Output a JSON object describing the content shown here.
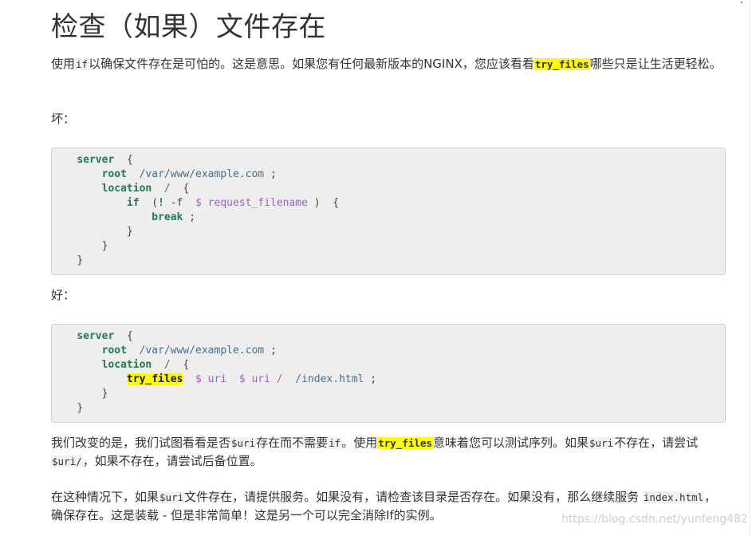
{
  "title": "检查（如果）文件存在",
  "intro": {
    "t1": "使用",
    "c1": "if",
    "t2": "以确保文件存在是可怕的。这是意思。如果您有任何最新版本的NGINX，您应该看看",
    "c2": "try_files",
    "t3": "哪些只是让生活更轻松。"
  },
  "bad_label": "坏：",
  "good_label": "好：",
  "bad_code": {
    "l1_kw": "server",
    "l1_p": "{",
    "l2_kw": "root",
    "l2_s": "/var/www/example.com",
    "l2_p": ";",
    "l3_kw": "location",
    "l3_s": "/",
    "l3_p": "{",
    "l4_kw": "if",
    "l4_p1": "(",
    "l4_op": "!",
    "l4_flag": "-f",
    "l4_var": "$ request_filename",
    "l4_p2": ")",
    "l4_p3": "{",
    "l5_kw": "break",
    "l5_p": ";",
    "l6_p": "}",
    "l7_p": "}",
    "l8_p": "}"
  },
  "good_code": {
    "l1_kw": "server",
    "l1_p": "{",
    "l2_kw": "root",
    "l2_s": "/var/www/example.com",
    "l2_p": ";",
    "l3_kw": "location",
    "l3_s": "/",
    "l3_p": "{",
    "l4_kw": "try_files",
    "l4_v1": "$ uri",
    "l4_v2": "$ uri /",
    "l4_s": "/index.html",
    "l4_p": ";",
    "l5_p": "}",
    "l6_p": "}"
  },
  "explain1": {
    "t1": "我们改变的是，我们试图看看是否",
    "c1": "$uri",
    "t2": "存在而不需要",
    "c2": "if",
    "t3": "。使用",
    "c3": "try_files",
    "t4": "意味着您可以测试序列。如果",
    "c4": "$uri",
    "t5": "不存在，请尝试 ",
    "c5": "$uri/",
    "t6": "，如果不存在，请尝试后备位置。"
  },
  "explain2": {
    "t1": "在这种情况下，如果",
    "c1": "$uri",
    "t2": "文件存在，请提供服务。如果没有，请检查该目录是否存在。如果没有，那么继续服务 ",
    "c2": "index.html",
    "t3": "，确保存在。这是装载 - 但是非常简单！这是另一个可以完全消除If的实例。"
  },
  "watermark": "https://blog.csdn.net/yunfeng482"
}
